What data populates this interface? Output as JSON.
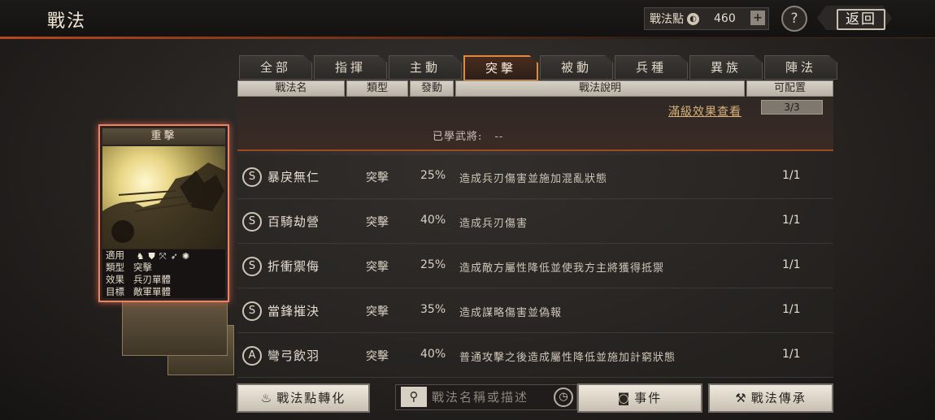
{
  "header": {
    "title": "戰法",
    "points_label": "戰法點",
    "points_value": "460",
    "plus": "+",
    "help": "?",
    "back": "返回"
  },
  "tabs": [
    {
      "label": "全部",
      "active": false
    },
    {
      "label": "指揮",
      "active": false
    },
    {
      "label": "主動",
      "active": false
    },
    {
      "label": "突擊",
      "active": true
    },
    {
      "label": "被動",
      "active": false
    },
    {
      "label": "兵種",
      "active": false
    },
    {
      "label": "異族",
      "active": false
    },
    {
      "label": "陣法",
      "active": false
    }
  ],
  "columns": {
    "name": "戰法名",
    "type": "類型",
    "trigger": "發動",
    "desc": "戰法說明",
    "config": "可配置"
  },
  "detail": {
    "max_effect_link": "滿級效果查看",
    "counter": "3/3",
    "learned_label": "已學武將:",
    "learned_value": "--"
  },
  "rows": [
    {
      "grade": "S",
      "name": "暴戾無仁",
      "type": "突擊",
      "rate": "25%",
      "desc": "造成兵刃傷害並施加混亂狀態",
      "count": "1/1"
    },
    {
      "grade": "S",
      "name": "百騎劫營",
      "type": "突擊",
      "rate": "40%",
      "desc": "造成兵刃傷害",
      "count": "1/1"
    },
    {
      "grade": "S",
      "name": "折衝禦侮",
      "type": "突擊",
      "rate": "25%",
      "desc": "造成敵方屬性降低並使我方主將獲得抵禦",
      "count": "1/1"
    },
    {
      "grade": "S",
      "name": "當鋒摧決",
      "type": "突擊",
      "rate": "35%",
      "desc": "造成謀略傷害並偽報",
      "count": "1/1"
    },
    {
      "grade": "A",
      "name": "彎弓飲羽",
      "type": "突擊",
      "rate": "40%",
      "desc": "普通攻擊之後造成屬性降低並施加計窮狀態",
      "count": "1/1"
    }
  ],
  "card": {
    "title": "重擊",
    "applies_label": "適用",
    "unit_icons": [
      "cavalry-icon",
      "shield-icon",
      "bow-icon",
      "spear-icon",
      "wheel-icon"
    ],
    "type_label": "類型",
    "type_value": "突擊",
    "effect_label": "效果",
    "effect_value": "兵刃單體",
    "target_label": "目標",
    "target_value": "敵軍單體"
  },
  "buttons": {
    "convert": "戰法點轉化",
    "search_placeholder": "戰法名稱或描述",
    "event": "事件",
    "inherit": "戰法傳承"
  },
  "colors": {
    "accent": "#e08a3c",
    "card_border": "#e8846a",
    "link": "#d8b27a"
  }
}
